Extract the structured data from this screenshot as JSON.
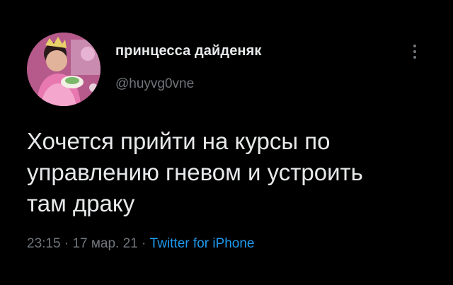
{
  "author": {
    "display_name": "принцесса дайденяк",
    "handle": "@huyvg0vne"
  },
  "tweet": {
    "lines": [
      "Хочется прийти на курсы по",
      "управлению гневом и устроить",
      "там драку"
    ]
  },
  "meta": {
    "time": "23:15",
    "separator1": " · ",
    "date": "17 мар. 21",
    "separator2": " · ",
    "source": "Twitter for iPhone"
  },
  "icons": {
    "more": "more-vertical-icon"
  },
  "colors": {
    "background": "#000000",
    "primary_text": "#e7e9ea",
    "secondary_text": "#71767b",
    "link": "#1d9bf0"
  }
}
